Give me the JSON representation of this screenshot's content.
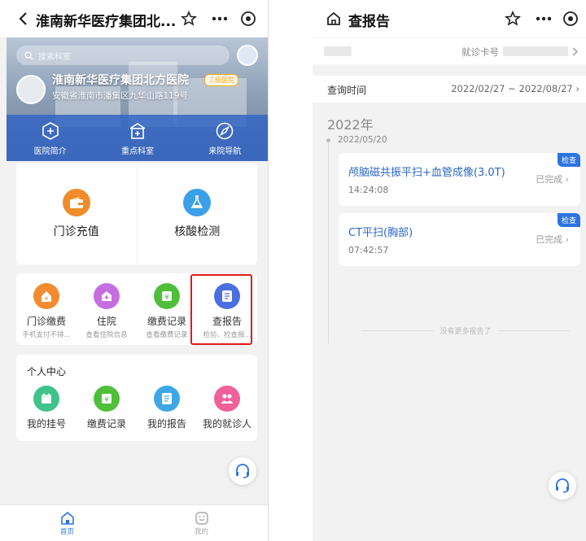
{
  "left": {
    "topbar": {
      "title": "淮南新华医疗集团北..."
    },
    "hero": {
      "search_placeholder": "搜索科室",
      "hospital_name": "淮南新华医疗集团北方医院",
      "hospital_tag": "三级医院",
      "address": "安徽省淮南市潘集区九华山路119号",
      "quick_links": [
        {
          "label": "医院简介",
          "icon": "plus-circle-icon"
        },
        {
          "label": "重点科室",
          "icon": "clinic-icon"
        },
        {
          "label": "来院导航",
          "icon": "navigation-icon"
        }
      ]
    },
    "big_services": [
      {
        "label": "门诊充值",
        "icon": "wallet-icon",
        "color": "#f08c2a"
      },
      {
        "label": "核酸检测",
        "icon": "flask-icon",
        "color": "#3aa0e8"
      }
    ],
    "services": [
      {
        "label": "门诊缴费",
        "sub": "手机支付不排...",
        "icon": "home-pay-icon",
        "color": "#f28b2f"
      },
      {
        "label": "住院",
        "sub": "查看住院信息",
        "icon": "hospital-icon",
        "color": "#c66ee0"
      },
      {
        "label": "缴费记录",
        "sub": "查看缴费记录",
        "icon": "yen-icon",
        "color": "#4fbf3a"
      },
      {
        "label": "查报告",
        "sub": "检验、检查报...",
        "icon": "report-icon",
        "color": "#4a6fe0"
      }
    ],
    "personal": {
      "title": "个人中心",
      "items": [
        {
          "label": "我的挂号",
          "icon": "calendar-icon",
          "color": "#3fc28c"
        },
        {
          "label": "缴费记录",
          "icon": "yen-icon",
          "color": "#4fbf3a"
        },
        {
          "label": "我的报告",
          "icon": "report-icon",
          "color": "#3ea7e8"
        },
        {
          "label": "我的就诊人",
          "icon": "people-icon",
          "color": "#f0609a"
        }
      ]
    },
    "tabs": [
      {
        "label": "首页",
        "active": true
      },
      {
        "label": "我的",
        "active": false
      }
    ]
  },
  "right": {
    "topbar": {
      "title": "查报告"
    },
    "card_label": "就诊卡号",
    "query": {
      "label": "查询时间",
      "range": "2022/02/27 ~ 2022/08/27"
    },
    "year": "2022年",
    "date": "2022/05/20",
    "reports": [
      {
        "name": "颅脑磁共振平扫+血管成像(3.0T)",
        "time": "14:24:08",
        "status": "已完成",
        "tag": "检查"
      },
      {
        "name": "CT平扫(胸部)",
        "time": "07:42:57",
        "status": "已完成",
        "tag": "检查"
      }
    ],
    "no_more": "没有更多报告了"
  },
  "colors": {
    "accent": "#2b73e0",
    "highlight": "#e01a1a"
  }
}
